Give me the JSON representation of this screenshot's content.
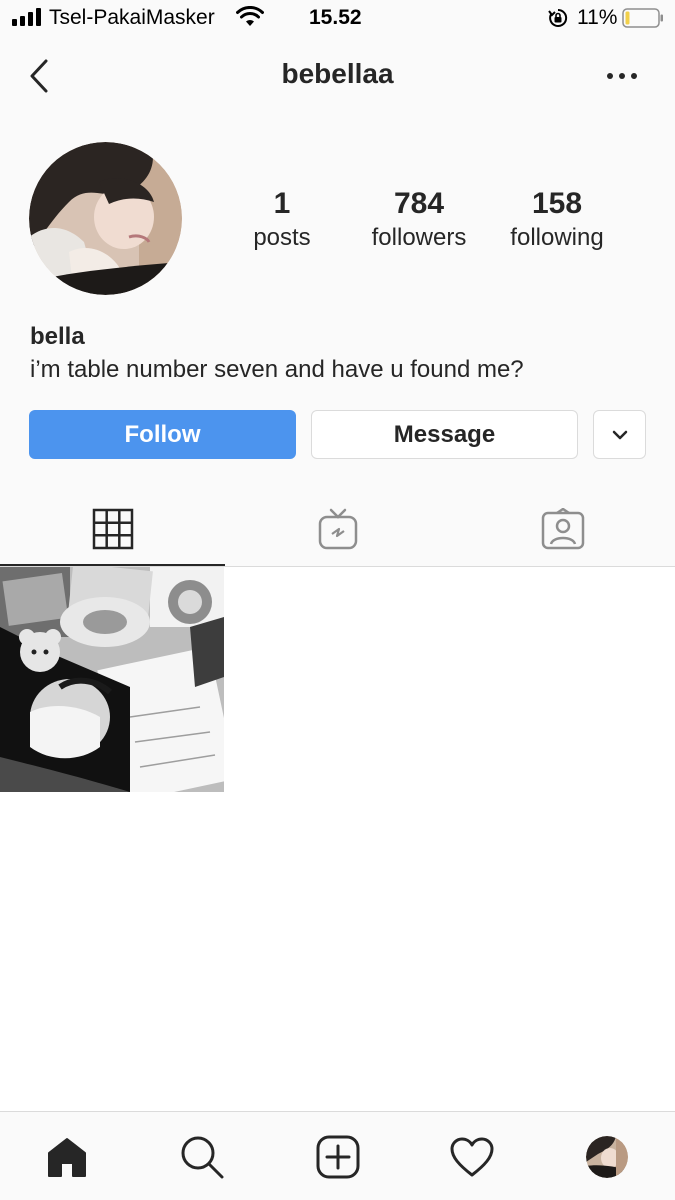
{
  "status_bar": {
    "carrier": "Tsel-PakaiMasker",
    "time": "15.52",
    "battery": "11%",
    "battery_level": 0.11,
    "icons": [
      "signal-icon",
      "wifi-icon",
      "rotation-lock-icon",
      "battery-icon"
    ]
  },
  "header": {
    "username": "bebellaa",
    "back_icon": "chevron-left-icon",
    "more_icon": "ellipsis-icon"
  },
  "profile": {
    "stats": {
      "posts": {
        "value": "1",
        "label": "posts"
      },
      "followers": {
        "value": "784",
        "label": "followers"
      },
      "following": {
        "value": "158",
        "label": "following"
      }
    },
    "name": "bella",
    "bio": "i’m table number seven and have u found me?"
  },
  "actions": {
    "follow_label": "Follow",
    "message_label": "Message",
    "suggest_icon": "chevron-down-icon"
  },
  "tabs": [
    {
      "name": "grid",
      "icon": "grid-icon",
      "active": true
    },
    {
      "name": "igtv",
      "icon": "igtv-icon",
      "active": false
    },
    {
      "name": "tagged",
      "icon": "tagged-user-icon",
      "active": false
    }
  ],
  "posts": [
    {
      "kind": "photo",
      "style": "black-and-white collage"
    }
  ],
  "bottom_nav": [
    {
      "name": "home",
      "icon": "home-icon",
      "active": true
    },
    {
      "name": "search",
      "icon": "search-icon",
      "active": false
    },
    {
      "name": "new-post",
      "icon": "add-post-icon",
      "active": false
    },
    {
      "name": "activity",
      "icon": "heart-icon",
      "active": false
    },
    {
      "name": "profile",
      "icon": "profile-avatar",
      "active": false
    }
  ],
  "colors": {
    "accent": "#4c94ee",
    "text": "#262626",
    "border": "#dbdbdb",
    "background": "#fafafa",
    "battery_low": "#f2d04a"
  }
}
